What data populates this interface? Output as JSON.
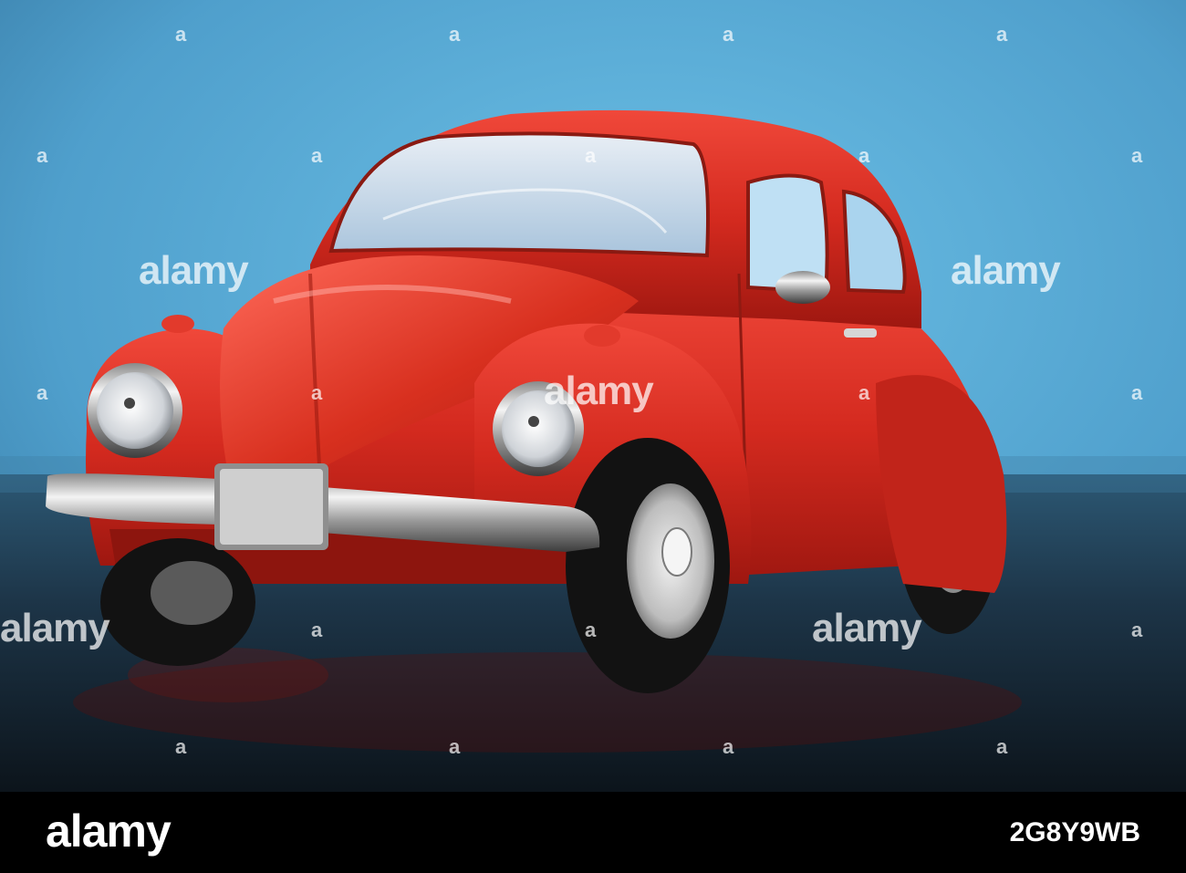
{
  "watermark": {
    "word": "alamy",
    "mark": "a"
  },
  "footer": {
    "brand": "alamy",
    "image_code": "2G8Y9WB"
  },
  "colors": {
    "background_blue": "#5fb0d8",
    "surface_dark": "#1b2a36",
    "car_red": "#d42a1f",
    "chrome": "#d9d9d9"
  }
}
